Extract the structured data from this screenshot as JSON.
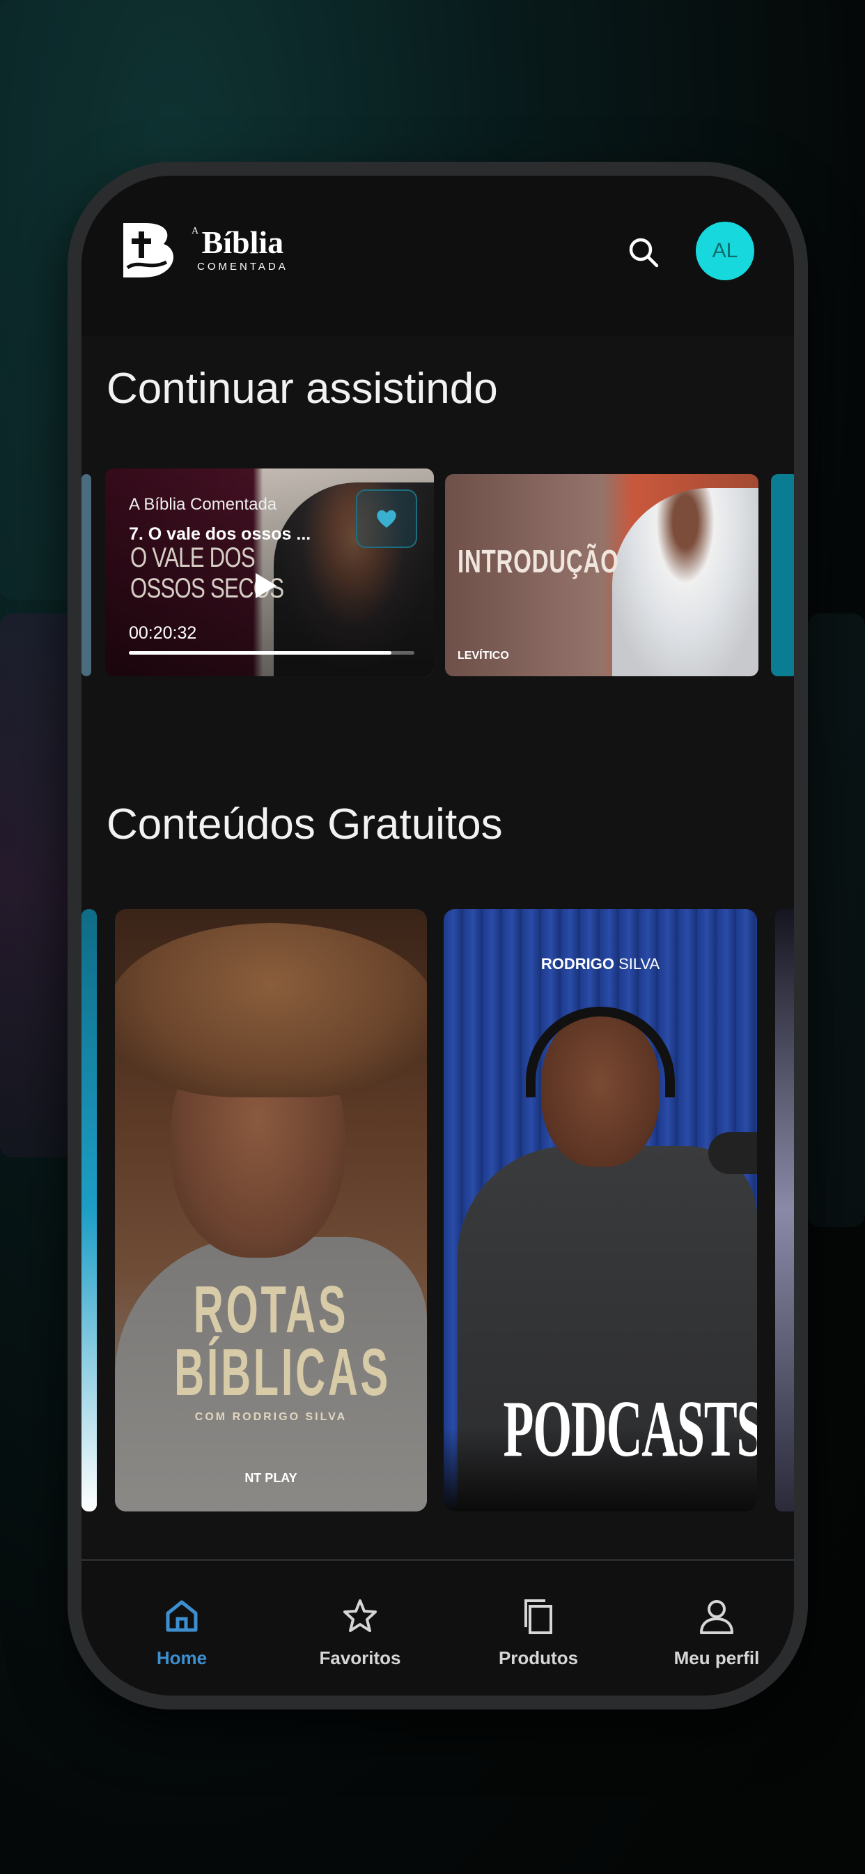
{
  "app": {
    "logo_prefix": "A",
    "logo_title": "Bíblia",
    "logo_subtitle": "COMENTADA",
    "avatar_initials": "AL"
  },
  "colors": {
    "accent": "#17d8dc",
    "nav_active": "#3e8fd0",
    "background": "#121212"
  },
  "icons": {
    "search": "search-icon",
    "home": "home-icon",
    "favorites": "star-icon",
    "products": "copy-icon",
    "profile": "user-icon"
  },
  "continue_watching": {
    "title": "Continuar assistindo",
    "cards": [
      {
        "series": "A Bíblia Comentada",
        "episode": "7. O vale dos ossos ...",
        "art_line1": "O VALE DOS",
        "art_line2": "OSSOS SECOS",
        "time": "00:20:32",
        "progress": 0.92
      },
      {
        "art_title": "INTRODUÇÃO",
        "art_label": "LEVÍTICO"
      }
    ]
  },
  "free_content": {
    "title": "Conteúdos Gratuitos",
    "posters": [
      {
        "title_line1": "ROTAS",
        "title_line2": "BÍBLICAS",
        "subtitle": "COM RODRIGO SILVA",
        "brand": "NT PLAY"
      },
      {
        "host_first": "RODRIGO",
        "host_last": "SILVA",
        "title": "PODCASTS"
      }
    ]
  },
  "nav": {
    "items": [
      {
        "label": "Home",
        "active": true
      },
      {
        "label": "Favoritos",
        "active": false
      },
      {
        "label": "Produtos",
        "active": false
      },
      {
        "label": "Meu perfil",
        "active": false
      }
    ]
  }
}
